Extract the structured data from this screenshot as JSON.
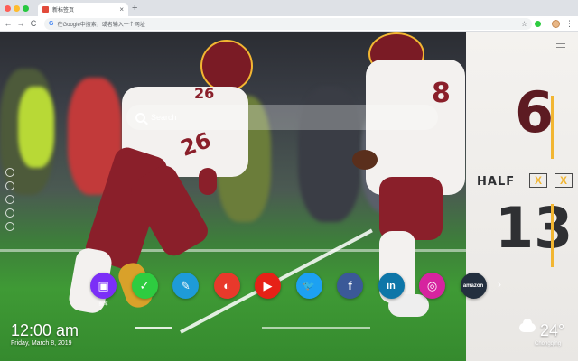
{
  "browser": {
    "tab_title": "新标签页",
    "tab_close": "×",
    "new_tab": "+",
    "back": "←",
    "forward": "→",
    "reload": "C",
    "omnibox_g": "G",
    "omnibox_placeholder": "在Google中搜索，或者输入一个网址",
    "bookmark_star": "☆",
    "menu": "⋮"
  },
  "search": {
    "placeholder": "Search"
  },
  "side_icons": [
    "search-icon",
    "settings-icon",
    "image-icon",
    "gear-icon",
    "info-icon"
  ],
  "promo": {
    "score_top": "6",
    "half_label": "HALF",
    "half_marks": [
      "X",
      "X"
    ],
    "score_bottom": "13"
  },
  "dock": {
    "apps": [
      {
        "name": "gallery",
        "icon": "image-icon",
        "label": "图库",
        "color": "#7b2ff7",
        "glyph": "▣"
      },
      {
        "name": "check",
        "icon": "check-icon",
        "label": "",
        "color": "#2ecc40",
        "glyph": "✓"
      },
      {
        "name": "notes",
        "icon": "note-icon",
        "label": "",
        "color": "#1e9bd8",
        "glyph": "✎"
      },
      {
        "name": "theme",
        "icon": "palette-icon",
        "label": "",
        "color": "#e8392b",
        "glyph": "◐"
      },
      {
        "name": "youtube",
        "icon": "youtube-icon",
        "label": "",
        "color": "#e62117",
        "glyph": "▶"
      },
      {
        "name": "twitter",
        "icon": "twitter-icon",
        "label": "",
        "color": "#1da1f2",
        "glyph": "🐦"
      },
      {
        "name": "facebook",
        "icon": "facebook-icon",
        "label": "",
        "color": "#3b5998",
        "glyph": "f"
      },
      {
        "name": "linkedin",
        "icon": "linkedin-icon",
        "label": "",
        "color": "#0e76a8",
        "glyph": "in"
      },
      {
        "name": "instagram",
        "icon": "instagram-icon",
        "label": "",
        "color": "#d6249f",
        "glyph": "◎"
      },
      {
        "name": "amazon",
        "icon": "amazon-icon",
        "label": "",
        "color": "#232f3e",
        "glyph": "amazon"
      }
    ],
    "more": "›"
  },
  "clock": {
    "time": "12:00 am",
    "date": "Friday, March 8, 2019"
  },
  "weather": {
    "temp": "24°",
    "city": "Chongqing"
  },
  "colors": {
    "brand_burgundy": "#7a1b25",
    "brand_gold": "#f2b632"
  }
}
